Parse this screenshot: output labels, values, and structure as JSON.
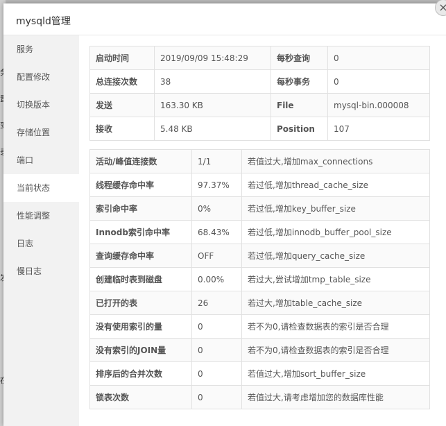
{
  "dialog": {
    "title": "mysqld管理",
    "close_glyph": "×"
  },
  "background_fragments": [
    "务",
    "置",
    "变",
    "录",
    "",
    "",
    "",
    "",
    "",
    "发",
    "在"
  ],
  "sidebar": {
    "items": [
      {
        "label": "服务"
      },
      {
        "label": "配置修改"
      },
      {
        "label": "切换版本"
      },
      {
        "label": "存储位置"
      },
      {
        "label": "端口"
      },
      {
        "label": "当前状态"
      },
      {
        "label": "性能调整"
      },
      {
        "label": "日志"
      },
      {
        "label": "慢日志"
      }
    ],
    "active_index": 5
  },
  "status_info": {
    "rows": [
      {
        "k1": "启动时间",
        "v1": "2019/09/09 15:48:29",
        "k2": "每秒查询",
        "v2": "0"
      },
      {
        "k1": "总连接次数",
        "v1": "38",
        "k2": "每秒事务",
        "v2": "0"
      },
      {
        "k1": "发送",
        "v1": "163.30 KB",
        "k2": "File",
        "v2": "mysql-bin.000008"
      },
      {
        "k1": "接收",
        "v1": "5.48 KB",
        "k2": "Position",
        "v2": "107"
      }
    ]
  },
  "performance": {
    "rows": [
      {
        "name": "活动/峰值连接数",
        "value": "1/1",
        "tip": "若值过大,增加max_connections"
      },
      {
        "name": "线程缓存命中率",
        "value": "97.37%",
        "tip": "若过低,增加thread_cache_size"
      },
      {
        "name": "索引命中率",
        "value": "0%",
        "tip": "若过低,增加key_buffer_size"
      },
      {
        "name": "Innodb索引命中率",
        "value": "68.43%",
        "tip": "若过低,增加innodb_buffer_pool_size"
      },
      {
        "name": "查询缓存命中率",
        "value": "OFF",
        "tip": "若过低,增加query_cache_size"
      },
      {
        "name": "创建临时表到磁盘",
        "value": "0.00%",
        "tip": "若过大,尝试增加tmp_table_size"
      },
      {
        "name": "已打开的表",
        "value": "26",
        "tip": "若过大,增加table_cache_size"
      },
      {
        "name": "没有使用索引的量",
        "value": "0",
        "tip": "若不为0,请检查数据表的索引是否合理"
      },
      {
        "name": "没有索引的JOIN量",
        "value": "0",
        "tip": "若不为0,请检查数据表的索引是否合理"
      },
      {
        "name": "排序后的合并次数",
        "value": "0",
        "tip": "若值过大,增加sort_buffer_size"
      },
      {
        "name": "锁表次数",
        "value": "0",
        "tip": "若值过大,请考虑增加您的数据库性能"
      }
    ]
  }
}
